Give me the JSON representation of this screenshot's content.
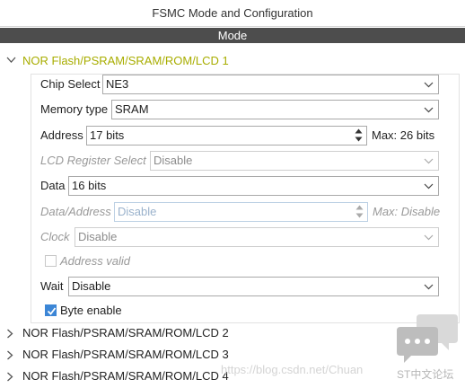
{
  "header": {
    "title": "FSMC Mode and Configuration",
    "mode_label": "Mode"
  },
  "sections": [
    {
      "label": "NOR Flash/PSRAM/SRAM/ROM/LCD 1",
      "expanded": true
    },
    {
      "label": "NOR Flash/PSRAM/SRAM/ROM/LCD 2",
      "expanded": false
    },
    {
      "label": "NOR Flash/PSRAM/SRAM/ROM/LCD 3",
      "expanded": false
    },
    {
      "label": "NOR Flash/PSRAM/SRAM/ROM/LCD 4",
      "expanded": false
    }
  ],
  "config": {
    "chip_select": {
      "label": "Chip Select",
      "value": "NE3"
    },
    "memory_type": {
      "label": "Memory type",
      "value": "SRAM"
    },
    "address": {
      "label": "Address",
      "value": "17 bits",
      "max": "Max: 26 bits"
    },
    "lcd_register_select": {
      "label": "LCD Register Select",
      "value": "Disable"
    },
    "data": {
      "label": "Data",
      "value": "16 bits"
    },
    "data_address": {
      "label": "Data/Address",
      "value": "Disable",
      "max": "Max: Disable"
    },
    "clock": {
      "label": "Clock",
      "value": "Disable"
    },
    "address_valid": {
      "label": "Address valid",
      "checked": false
    },
    "wait": {
      "label": "Wait",
      "value": "Disable"
    },
    "byte_enable": {
      "label": "Byte enable",
      "checked": true
    }
  },
  "watermark": {
    "url": "https://blog.csdn.net/Chuan",
    "brand": "ST中文论坛"
  },
  "colors": {
    "active_section": "#a8ad00",
    "mode_bar": "#4d4d4d",
    "checkbox_on": "#3c86d6"
  },
  "icons": {
    "collapse": "chevron-down-icon",
    "expand": "chevron-right-icon",
    "dropdown": "chevron-down-icon"
  }
}
